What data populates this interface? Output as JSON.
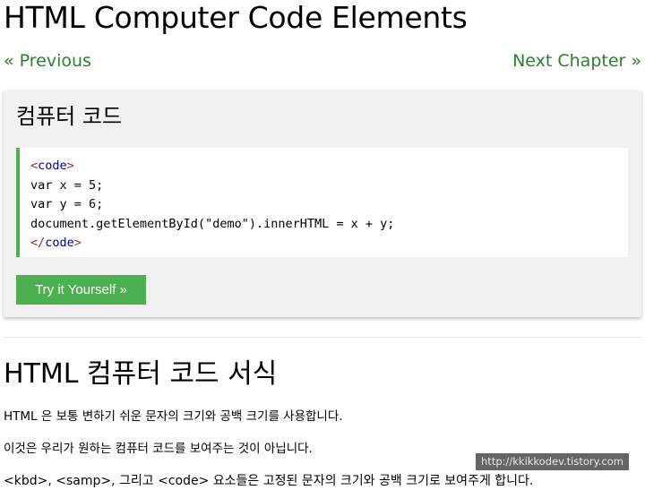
{
  "page": {
    "title": "HTML Computer Code Elements"
  },
  "nav": {
    "previous_label": "« Previous",
    "next_label": "Next Chapter »"
  },
  "example": {
    "heading": "컴퓨터 코드",
    "code": {
      "open_tag_lt": "<",
      "tag_name": "code",
      "open_tag_gt": ">",
      "line2": "var x = 5;",
      "line3": "var y = 6;",
      "line4": "document.getElementById(\"demo\").innerHTML = x + y;",
      "close_tag_lt": "</",
      "close_tag_gt": ">"
    },
    "try_button_label": "Try it Yourself »"
  },
  "section": {
    "title": "HTML 컴퓨터 코드 서식",
    "paragraph1": "HTML 은 보통 변하기 쉬운 문자의 크기와 공백 크기를 사용합니다.",
    "paragraph2": "이것은 우리가 원하는 컴퓨터 코드를 보여주는 것이 아닙니다.",
    "paragraph3": "<kbd>, <samp>, 그리고 <code> 요소들은 고정된 문자의 크기와 공백 크기로 보여주게 합니다."
  },
  "watermark": "http://kkikkodev.tistory.com",
  "colors": {
    "accent_green": "#4caf50",
    "link_green": "#2e7d32",
    "panel_bg": "#f1f1f1",
    "tag_brown": "#a52a2a",
    "tag_blue": "#00008b"
  }
}
